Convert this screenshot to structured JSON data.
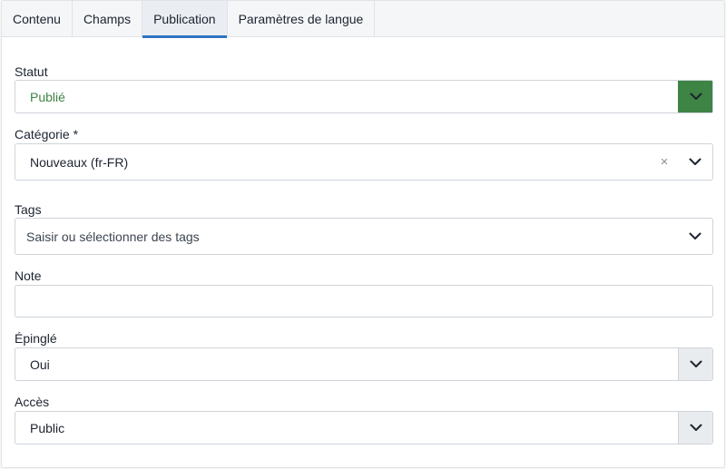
{
  "tabs": [
    {
      "label": "Contenu",
      "active": false
    },
    {
      "label": "Champs",
      "active": false
    },
    {
      "label": "Publication",
      "active": true
    },
    {
      "label": "Paramètres de langue",
      "active": false
    }
  ],
  "fields": {
    "statut": {
      "label": "Statut",
      "value": "Publié",
      "value_color": "#3e8444"
    },
    "categorie": {
      "label": "Catégorie *",
      "value": "Nouveaux (fr-FR)",
      "clear": "×"
    },
    "tags": {
      "label": "Tags",
      "placeholder": "Saisir ou sélectionner des tags"
    },
    "note": {
      "label": "Note",
      "value": ""
    },
    "epingle": {
      "label": "Épinglé",
      "value": "Oui"
    },
    "acces": {
      "label": "Accès",
      "value": "Public"
    }
  },
  "colors": {
    "accent_tab": "#2e73c1",
    "published_green": "#3e8444"
  },
  "icons": {
    "chevron": "chevron-down-icon",
    "clear": "close-icon"
  }
}
